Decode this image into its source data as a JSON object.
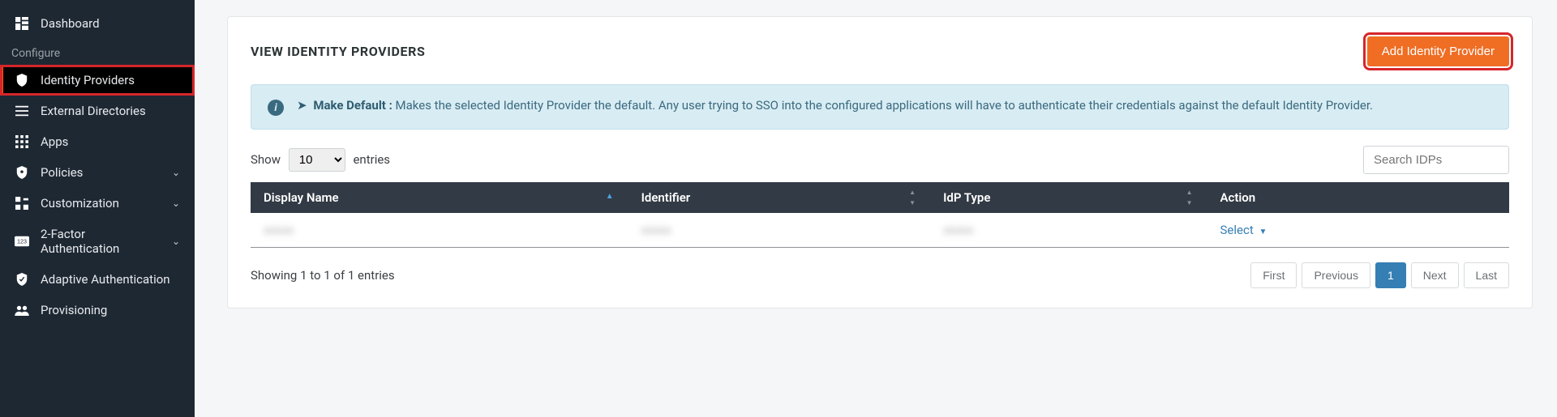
{
  "sidebar": {
    "items": [
      {
        "label": "Dashboard",
        "icon": "grid"
      }
    ],
    "section_label": "Configure",
    "config_items": [
      {
        "label": "Identity Providers",
        "icon": "shield",
        "active": true
      },
      {
        "label": "External Directories",
        "icon": "menu"
      },
      {
        "label": "Apps",
        "icon": "apps"
      },
      {
        "label": "Policies",
        "icon": "shield-q",
        "chevron": true
      },
      {
        "label": "Customization",
        "icon": "custom",
        "chevron": true
      },
      {
        "label": "2-Factor Authentication",
        "icon": "twofa",
        "chevron": true
      },
      {
        "label": "Adaptive Authentication",
        "icon": "shield-check"
      },
      {
        "label": "Provisioning",
        "icon": "users"
      }
    ]
  },
  "header": {
    "title": "VIEW IDENTITY PROVIDERS",
    "add_button": "Add Identity Provider"
  },
  "info": {
    "label": "Make Default :",
    "text": "Makes the selected Identity Provider the default. Any user trying to SSO into the configured applications will have to authenticate their credentials against the default Identity Provider."
  },
  "table": {
    "show_label_prefix": "Show",
    "show_label_suffix": "entries",
    "show_value": "10",
    "search_placeholder": "Search IDPs",
    "columns": [
      "Display Name",
      "Identifier",
      "IdP Type",
      "Action"
    ],
    "rows": [
      {
        "display_name": "xxxxx",
        "identifier": "xxxxx",
        "idp_type": "xxxxx",
        "action": "Select"
      }
    ],
    "footer_text": "Showing 1 to 1 of 1 entries",
    "pagination": {
      "first": "First",
      "previous": "Previous",
      "page": "1",
      "next": "Next",
      "last": "Last"
    }
  }
}
